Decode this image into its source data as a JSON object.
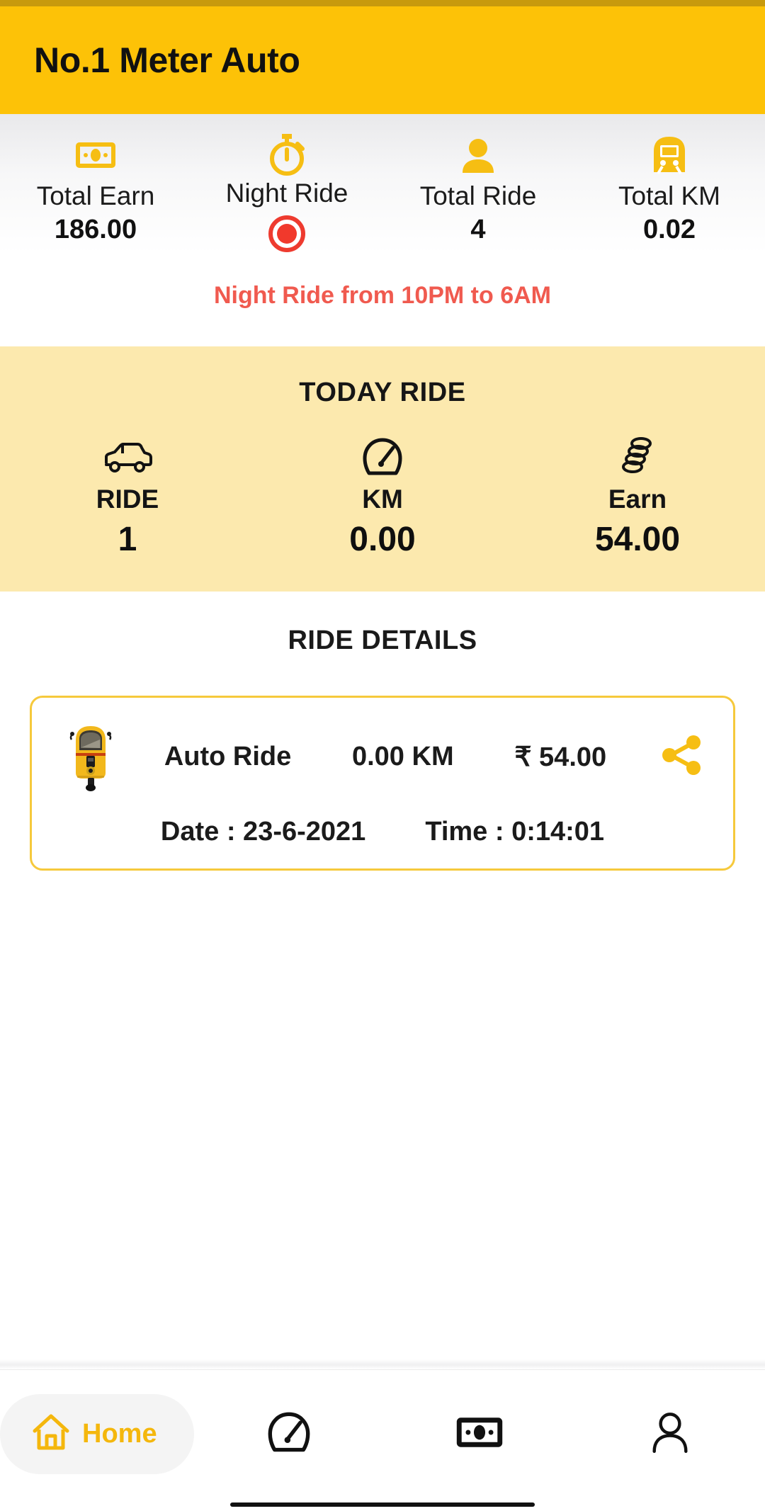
{
  "header": {
    "title": "No.1 Meter Auto",
    "bg_color": "#FDC207",
    "status_strip_color": "#C89A0D"
  },
  "summary_stats": [
    {
      "icon": "banknote-icon",
      "label": "Total Earn",
      "value": "186.00"
    },
    {
      "icon": "stopwatch-icon",
      "label": "Night Ride",
      "value": "",
      "indicator": "record-dot"
    },
    {
      "icon": "person-icon",
      "label": "Total Ride",
      "value": "4"
    },
    {
      "icon": "train-icon",
      "label": "Total KM",
      "value": "0.02"
    }
  ],
  "night_notice": {
    "text": "Night Ride from 10PM to 6AM",
    "color": "#F05A4F"
  },
  "today_ride": {
    "title": "TODAY RIDE",
    "bg_color": "#FCE9AE",
    "cells": [
      {
        "icon": "car-icon",
        "label": "RIDE",
        "value": "1"
      },
      {
        "icon": "speedometer-icon",
        "label": "KM",
        "value": "0.00"
      },
      {
        "icon": "coins-icon",
        "label": "Earn",
        "value": "54.00"
      }
    ]
  },
  "ride_details": {
    "title": "RIDE DETAILS",
    "card_border_color": "#F6C93C",
    "rides": [
      {
        "thumb": "auto-rickshaw-image",
        "type": "Auto Ride",
        "distance": "0.00 KM",
        "fare": "₹ 54.00",
        "share_icon": "share-icon",
        "date_label": "Date : 23-6-2021",
        "time_label": "Time : 0:14:01"
      }
    ]
  },
  "bottom_nav": {
    "active_color": "#F4B70D",
    "items": [
      {
        "icon": "home-icon",
        "label": "Home",
        "active": true
      },
      {
        "icon": "speedometer-icon",
        "label": "",
        "active": false
      },
      {
        "icon": "banknote-icon",
        "label": "",
        "active": false
      },
      {
        "icon": "person-icon",
        "label": "",
        "active": false
      }
    ]
  }
}
